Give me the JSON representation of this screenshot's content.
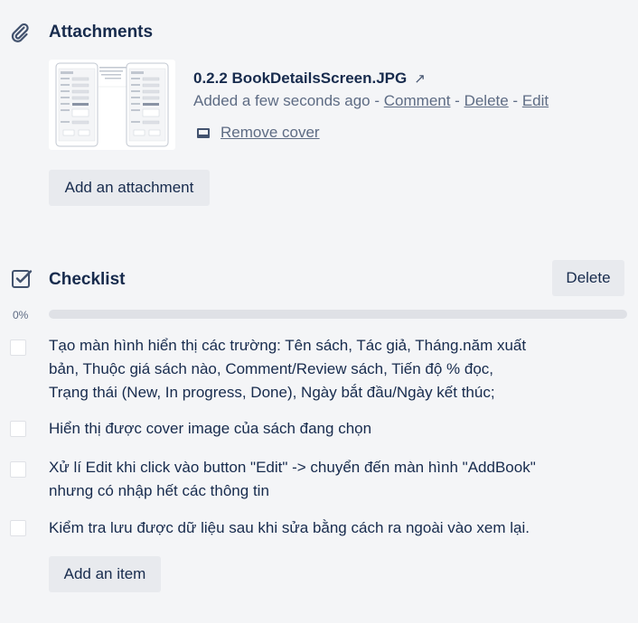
{
  "attachments": {
    "title": "Attachments",
    "icon": "paperclip-icon",
    "item": {
      "name": "0.2.2 BookDetailsScreen.JPG",
      "open_icon": "↗",
      "added": "Added a few seconds ago",
      "sep": " - ",
      "comment": "Comment",
      "delete": "Delete",
      "edit": "Edit",
      "remove_cover": "Remove cover"
    },
    "add_button": "Add an attachment"
  },
  "checklist": {
    "title": "Checklist",
    "icon": "checkbox-icon",
    "delete_button": "Delete",
    "progress_label": "0%",
    "progress_value": 0,
    "items": [
      {
        "text": "Tạo màn hình hiển thị các trường: Tên sách, Tác giả, Tháng.năm xuất bản, Thuộc giá sách nào, Comment/Review sách, Tiến độ % đọc, Trạng thái (New, In progress, Done), Ngày bắt đầu/Ngày kết thúc;",
        "checked": false
      },
      {
        "text": "Hiển thị được cover image của sách đang chọn",
        "checked": false
      },
      {
        "text": "Xử lí Edit khi click vào button \"Edit\" -> chuyển đến màn hình \"AddBook\" nhưng có nhập hết các thông tin",
        "checked": false
      },
      {
        "text": "Kiểm tra lưu được dữ liệu sau khi sửa bằng cách ra ngoài vào xem lại.",
        "checked": false
      }
    ],
    "add_button": "Add an item"
  },
  "colors": {
    "background": "#f4f5f7",
    "text": "#172b4d",
    "muted": "#5e6c84",
    "button": "#e8eaee",
    "progress_track": "#dfe1e6"
  }
}
